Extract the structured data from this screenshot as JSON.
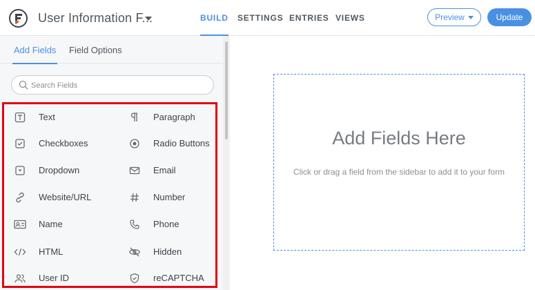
{
  "header": {
    "form_title": "User Information F...",
    "nav": [
      "BUILD",
      "SETTINGS",
      "ENTRIES",
      "VIEWS"
    ],
    "active_nav": "BUILD",
    "preview_label": "Preview",
    "update_label": "Update",
    "accent_color": "#4a90e2"
  },
  "sidebar": {
    "tabs": [
      "Add Fields",
      "Field Options"
    ],
    "active_tab": "Add Fields",
    "search_placeholder": "Search Fields",
    "fields": [
      {
        "label": "Text",
        "icon": "text-field-icon"
      },
      {
        "label": "Paragraph",
        "icon": "paragraph-icon"
      },
      {
        "label": "Checkboxes",
        "icon": "checkbox-icon"
      },
      {
        "label": "Radio Buttons",
        "icon": "radio-button-icon"
      },
      {
        "label": "Dropdown",
        "icon": "dropdown-icon"
      },
      {
        "label": "Email",
        "icon": "email-icon"
      },
      {
        "label": "Website/URL",
        "icon": "link-icon"
      },
      {
        "label": "Number",
        "icon": "hash-icon"
      },
      {
        "label": "Name",
        "icon": "id-card-icon"
      },
      {
        "label": "Phone",
        "icon": "phone-icon"
      },
      {
        "label": "HTML",
        "icon": "code-icon"
      },
      {
        "label": "Hidden",
        "icon": "eye-slash-icon"
      },
      {
        "label": "User ID",
        "icon": "users-icon"
      },
      {
        "label": "reCAPTCHA",
        "icon": "shield-check-icon"
      }
    ],
    "highlight_color": "#e3000f"
  },
  "canvas": {
    "title": "Add Fields Here",
    "subtitle": "Click or drag a field from the sidebar to add it to your form"
  }
}
